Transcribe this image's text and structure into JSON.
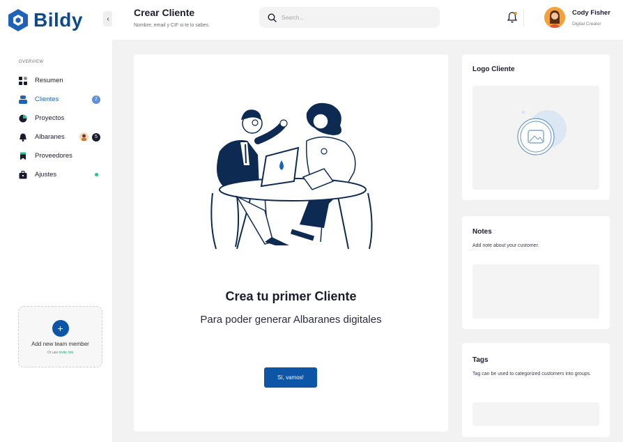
{
  "brand": {
    "name": "Bildy",
    "color": "#0b4a8c"
  },
  "sidebar": {
    "section_label": "OVERVIEW",
    "items": [
      {
        "label": "Resumen",
        "icon": "grid-icon"
      },
      {
        "label": "Clientes",
        "icon": "users-icon",
        "badge": "2",
        "active": true
      },
      {
        "label": "Proyectos",
        "icon": "pie-chart-icon"
      },
      {
        "label": "Albaranes",
        "icon": "bell-icon",
        "badge": "5"
      },
      {
        "label": "Proveedores",
        "icon": "bookmark-icon"
      },
      {
        "label": "Ajustes",
        "icon": "briefcase-icon"
      }
    ],
    "team_card": {
      "title": "Add new team member",
      "sub_prefix": "Or use",
      "sub_link": "invite link"
    }
  },
  "header": {
    "title": "Crear Cliente",
    "subtitle": "Nombre, email y CIF si te lo sabes.",
    "search_placeholder": "Search...",
    "user": {
      "name": "Cody Fisher",
      "role": "Digital Creator"
    }
  },
  "main": {
    "empty_title": "Crea tu primer Cliente",
    "empty_subtitle": "Para poder generar Albaranes digitales",
    "cta_label": "Sí, vamos!"
  },
  "side": {
    "logo": {
      "title": "Logo Cliente"
    },
    "notes": {
      "title": "Notes",
      "description": "Add note about your customer."
    },
    "tags": {
      "title": "Tags",
      "description": "Tag can be used to categorized customers into groups."
    }
  },
  "colors": {
    "accent": "#0d55a6",
    "active_nav": "#1e63b8",
    "online": "#22c58a",
    "notification": "#f29b1d"
  }
}
